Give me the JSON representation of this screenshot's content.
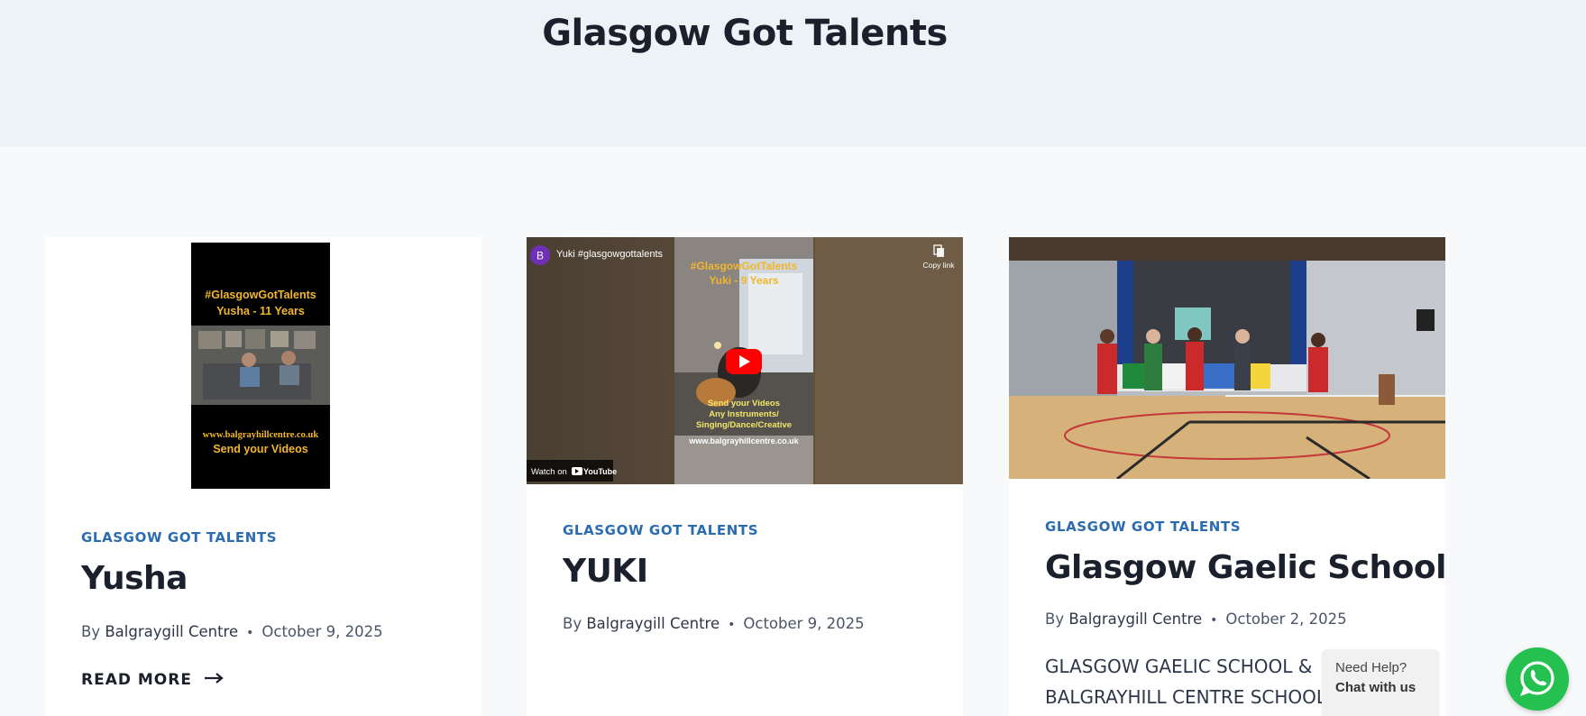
{
  "page": {
    "title": "Glasgow Got Talents"
  },
  "posts": [
    {
      "category": "GLASGOW GOT TALENTS",
      "title": "Yusha",
      "by": "By",
      "author": "Balgraygill Centre",
      "date": "October 9, 2025",
      "read_more": "READ MORE",
      "thumbnail": {
        "line1": "#GlasgowGotTalents",
        "line2": "Yusha - 11 Years",
        "url": "www.balgrayhillcentre.co.uk",
        "cta": "Send your Videos"
      }
    },
    {
      "category": "GLASGOW GOT TALENTS",
      "title": "YUKI",
      "by": "By",
      "author": "Balgraygill Centre",
      "date": "October 9, 2025",
      "video": {
        "channel_initial": "B",
        "video_title": "Yuki #glasgowgottalents",
        "copy_link": "Copy link",
        "overlay_line1": "#GlasgowGotTalents",
        "overlay_line2": "Yuki - 9 Years",
        "cta1": "Send your Videos",
        "cta2": "Any Instruments/",
        "cta3": "Singing/Dance/Creative",
        "url": "www.balgrayhillcentre.co.uk",
        "watch_on": "Watch on",
        "youtube": "YouTube"
      }
    },
    {
      "category": "GLASGOW GOT TALENTS",
      "title": "Glasgow Gaelic School",
      "by": "By",
      "author": "Balgraygill Centre",
      "date": "October 2, 2025",
      "excerpt": "GLASGOW GAELIC SCHOOL & BALGRAYHILL CENTRE SCHOOL."
    }
  ],
  "chat_widget": {
    "line1": "Need Help?",
    "line2": "Chat with us",
    "icon": "whatsapp-icon",
    "color": "#25c150"
  }
}
